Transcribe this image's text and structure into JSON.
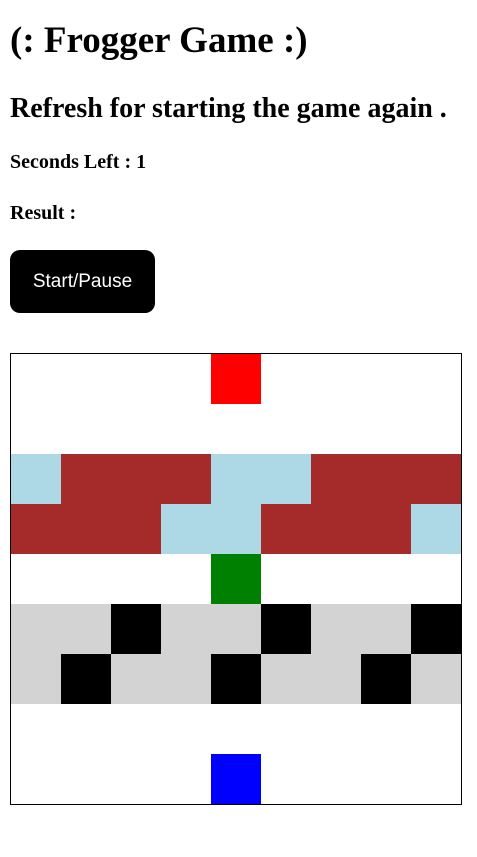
{
  "title": "(: Frogger Game :)",
  "subtitle": "Refresh for starting the game again .",
  "seconds": {
    "label": "Seconds Left : ",
    "value": "1"
  },
  "result": {
    "label": "Result : ",
    "value": ""
  },
  "start_button": {
    "label": "Start/Pause",
    "color": "#000000"
  },
  "colors": {
    "empty": "#ffffff",
    "ending_block": "#ff0000",
    "starting_block": "#0000ff",
    "frog": "#008000",
    "log": "#a52a2a",
    "river": "#add8e6",
    "road": "#d3d3d3",
    "car": "#000000"
  },
  "board": {
    "columns": 9,
    "rows": [
      [
        "empty",
        "empty",
        "empty",
        "empty",
        "ending_block",
        "empty",
        "empty",
        "empty",
        "empty"
      ],
      [
        "empty",
        "empty",
        "empty",
        "empty",
        "empty",
        "empty",
        "empty",
        "empty",
        "empty"
      ],
      [
        "river",
        "log",
        "log",
        "log",
        "river",
        "river",
        "log",
        "log",
        "log"
      ],
      [
        "log",
        "log",
        "log",
        "river",
        "river",
        "log",
        "log",
        "log",
        "river"
      ],
      [
        "empty",
        "empty",
        "empty",
        "empty",
        "frog",
        "empty",
        "empty",
        "empty",
        "empty"
      ],
      [
        "road",
        "road",
        "car",
        "road",
        "road",
        "car",
        "road",
        "road",
        "car"
      ],
      [
        "road",
        "car",
        "road",
        "road",
        "car",
        "road",
        "road",
        "car",
        "road"
      ],
      [
        "empty",
        "empty",
        "empty",
        "empty",
        "empty",
        "empty",
        "empty",
        "empty",
        "empty"
      ],
      [
        "empty",
        "empty",
        "empty",
        "empty",
        "starting_block",
        "empty",
        "empty",
        "empty",
        "empty"
      ]
    ]
  }
}
